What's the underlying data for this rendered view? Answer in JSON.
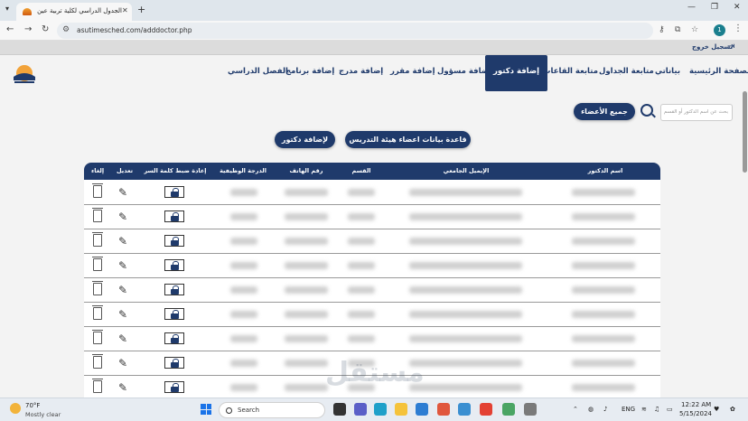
{
  "browser": {
    "tab_title": "الجدول الدراسي لكلية تربية عين ش",
    "url": "asutimesched.com/adddoctor.php"
  },
  "header": {
    "logout_label": "تسجيل خروج",
    "nav": [
      {
        "label": "الصفحة الرئيسية",
        "active": false
      },
      {
        "label": "بياناتي",
        "active": false
      },
      {
        "label": "متابعة الجداول",
        "active": false
      },
      {
        "label": "متابعة القاعات",
        "active": false
      },
      {
        "label": "إضافة دكتور",
        "active": true
      },
      {
        "label": "إضافة مسؤول",
        "active": false
      },
      {
        "label": "إضافة مقرر",
        "active": false
      },
      {
        "label": "إضافة مدرج",
        "active": false
      },
      {
        "label": "إضافة برنامج",
        "active": false
      },
      {
        "label": "الفصل الدراسي",
        "active": false
      }
    ]
  },
  "toolbar": {
    "search_placeholder": "بحث عن اسم الدكتور أو القسم",
    "all_members_label": "جميع الأعضاء",
    "faculty_db_label": "قاعدة بيانات اعضاء هيئة التدريس",
    "add_doctor_label": "لإضافة دكتور"
  },
  "table": {
    "headers": {
      "name": "اسم الدكتور",
      "email": "الإيميل الجامعي",
      "department": "القسم",
      "phone": "رقم الهاتف",
      "rank": "الدرجة الوظيفية",
      "reset_password": "إعادة ضبط كلمة السر",
      "edit": "تعديل",
      "delete": "إلغاء"
    }
  },
  "watermark": "مستقل",
  "taskbar": {
    "temperature": "70°F",
    "weather": "Mostly clear",
    "search_label": "Search",
    "language": "ENG",
    "time": "12:22 AM",
    "date": "5/15/2024"
  },
  "colors": {
    "primary": "#1f3a6b",
    "page_bg": "#f3f3f3"
  }
}
